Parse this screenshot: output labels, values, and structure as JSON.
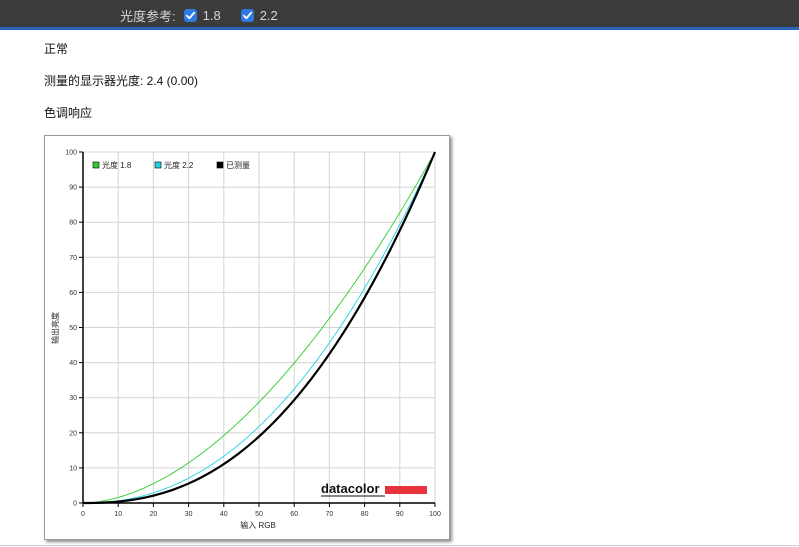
{
  "topbar": {
    "gamma_reference_label": "光度参考:",
    "checkbox_1": {
      "label": "1.8",
      "checked": true
    },
    "checkbox_2": {
      "label": "2.2",
      "checked": true
    },
    "accent_color": "#2a64b8",
    "checkbox_color": "#2f79e4"
  },
  "content": {
    "mode_label": "正常",
    "measured_gamma_label": "测量的显示器光度: 2.4 (0.00)",
    "section_title": "色调响应"
  },
  "chart_data": {
    "type": "line",
    "xlabel": "输入 RGB",
    "ylabel": "输出亮度",
    "xlim": [
      0,
      100
    ],
    "ylim": [
      0,
      100
    ],
    "x_ticks": [
      0,
      10,
      20,
      30,
      40,
      50,
      60,
      70,
      80,
      90,
      100
    ],
    "y_ticks": [
      0,
      10,
      20,
      30,
      40,
      50,
      60,
      70,
      80,
      90,
      100
    ],
    "grid": true,
    "legend_position": "top-left",
    "series": [
      {
        "name": "光度 1.8",
        "color": "#2ecc2e",
        "gamma": 1.8,
        "x": [
          0,
          10,
          20,
          30,
          40,
          50,
          60,
          70,
          80,
          90,
          100
        ],
        "values": [
          0,
          1.6,
          5.5,
          11.5,
          19.2,
          28.7,
          39.9,
          52.6,
          66.9,
          82.7,
          100
        ]
      },
      {
        "name": "光度 2.2",
        "color": "#22d3e6",
        "gamma": 2.2,
        "x": [
          0,
          10,
          20,
          30,
          40,
          50,
          60,
          70,
          80,
          90,
          100
        ],
        "values": [
          0,
          0.6,
          2.9,
          7.1,
          13.3,
          21.8,
          32.5,
          45.6,
          61.2,
          79.3,
          100
        ]
      },
      {
        "name": "已测量",
        "color": "#000000",
        "gamma": 2.4,
        "x": [
          0,
          10,
          20,
          30,
          40,
          50,
          60,
          70,
          80,
          90,
          100
        ],
        "values": [
          0,
          0.4,
          2.1,
          5.6,
          11.1,
          18.9,
          29.3,
          42.5,
          58.5,
          77.6,
          100
        ]
      }
    ]
  },
  "watermark": {
    "text": "datacolor",
    "bar_color": "#e8333b"
  }
}
